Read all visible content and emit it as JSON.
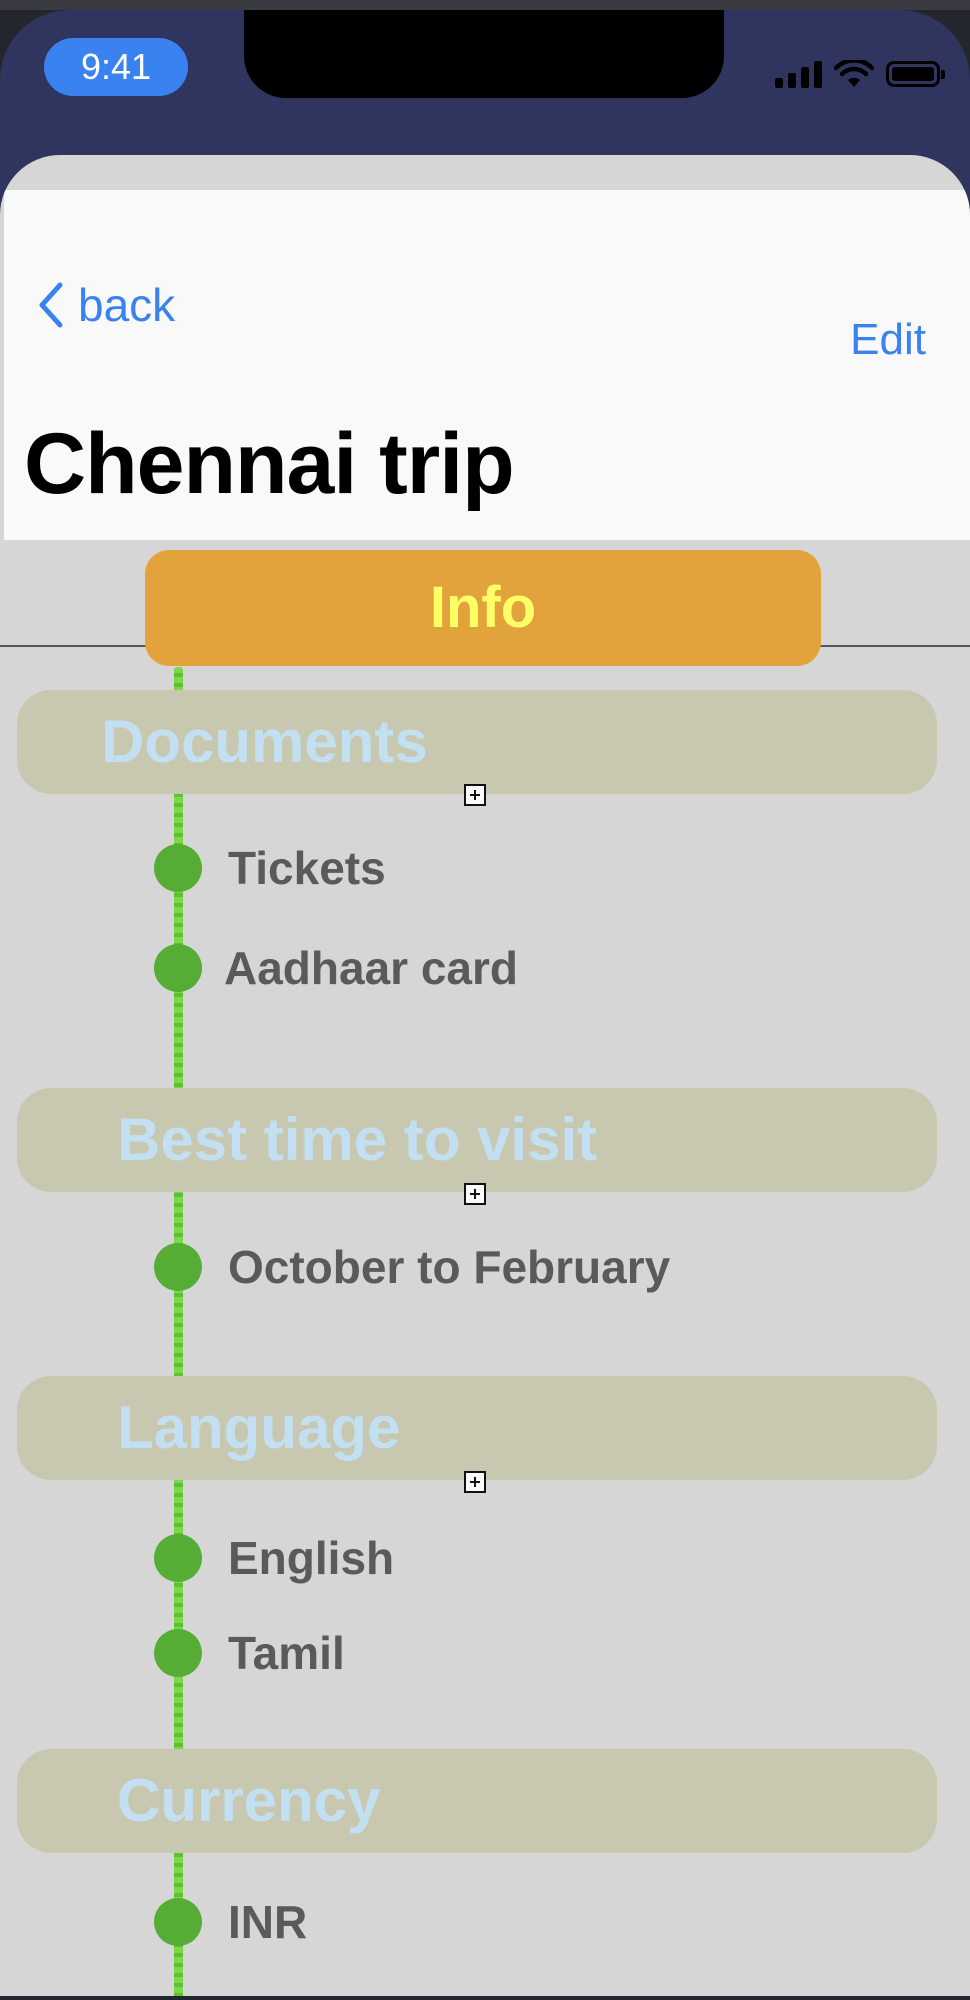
{
  "status_bar": {
    "time": "9:41"
  },
  "nav": {
    "back_label": "back",
    "edit_label": "Edit"
  },
  "page": {
    "title": "Chennai trip"
  },
  "tab": {
    "label": "Info",
    "color": "#e2a23c",
    "text_color": "#ffff66"
  },
  "sections": [
    {
      "title": "Documents",
      "items": [
        "Tickets",
        "Aadhaar card"
      ]
    },
    {
      "title": "Best time to visit",
      "items": [
        "October to February"
      ]
    },
    {
      "title": "Language",
      "items": [
        "English",
        "Tamil"
      ]
    },
    {
      "title": "Currency",
      "items": [
        "INR"
      ]
    }
  ],
  "colors": {
    "accent": "#3a82f0",
    "timeline": "#6cca3c",
    "bullet": "#55ad36",
    "section_background": "#c8c8b0",
    "section_title": "#c3dff2",
    "phone_background": "#2f355f"
  },
  "icons": {
    "back": "chevron-left-icon",
    "expand": "plus-square-icon",
    "signal": "cellular-signal-icon",
    "wifi": "wifi-icon",
    "battery": "battery-icon"
  }
}
